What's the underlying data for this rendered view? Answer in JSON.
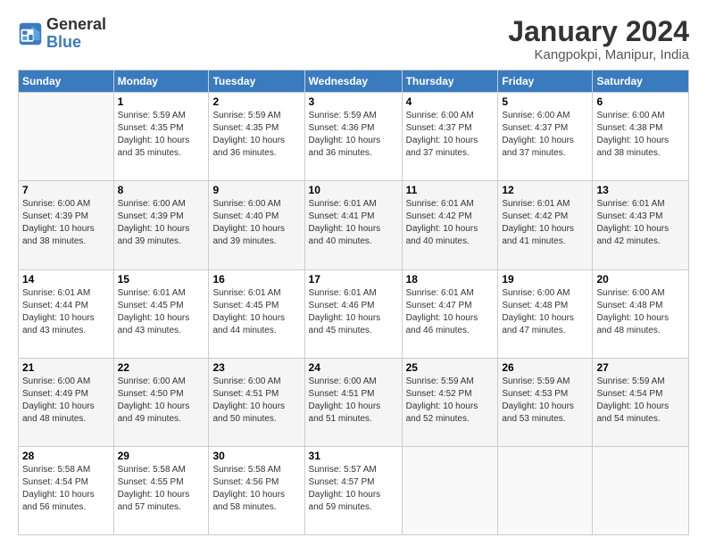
{
  "logo": {
    "text_general": "General",
    "text_blue": "Blue"
  },
  "title": "January 2024",
  "subtitle": "Kangpokpi, Manipur, India",
  "header_days": [
    "Sunday",
    "Monday",
    "Tuesday",
    "Wednesday",
    "Thursday",
    "Friday",
    "Saturday"
  ],
  "weeks": [
    [
      {
        "day": "",
        "info": ""
      },
      {
        "day": "1",
        "info": "Sunrise: 5:59 AM\nSunset: 4:35 PM\nDaylight: 10 hours\nand 35 minutes."
      },
      {
        "day": "2",
        "info": "Sunrise: 5:59 AM\nSunset: 4:35 PM\nDaylight: 10 hours\nand 36 minutes."
      },
      {
        "day": "3",
        "info": "Sunrise: 5:59 AM\nSunset: 4:36 PM\nDaylight: 10 hours\nand 36 minutes."
      },
      {
        "day": "4",
        "info": "Sunrise: 6:00 AM\nSunset: 4:37 PM\nDaylight: 10 hours\nand 37 minutes."
      },
      {
        "day": "5",
        "info": "Sunrise: 6:00 AM\nSunset: 4:37 PM\nDaylight: 10 hours\nand 37 minutes."
      },
      {
        "day": "6",
        "info": "Sunrise: 6:00 AM\nSunset: 4:38 PM\nDaylight: 10 hours\nand 38 minutes."
      }
    ],
    [
      {
        "day": "7",
        "info": "Sunrise: 6:00 AM\nSunset: 4:39 PM\nDaylight: 10 hours\nand 38 minutes."
      },
      {
        "day": "8",
        "info": "Sunrise: 6:00 AM\nSunset: 4:39 PM\nDaylight: 10 hours\nand 39 minutes."
      },
      {
        "day": "9",
        "info": "Sunrise: 6:00 AM\nSunset: 4:40 PM\nDaylight: 10 hours\nand 39 minutes."
      },
      {
        "day": "10",
        "info": "Sunrise: 6:01 AM\nSunset: 4:41 PM\nDaylight: 10 hours\nand 40 minutes."
      },
      {
        "day": "11",
        "info": "Sunrise: 6:01 AM\nSunset: 4:42 PM\nDaylight: 10 hours\nand 40 minutes."
      },
      {
        "day": "12",
        "info": "Sunrise: 6:01 AM\nSunset: 4:42 PM\nDaylight: 10 hours\nand 41 minutes."
      },
      {
        "day": "13",
        "info": "Sunrise: 6:01 AM\nSunset: 4:43 PM\nDaylight: 10 hours\nand 42 minutes."
      }
    ],
    [
      {
        "day": "14",
        "info": "Sunrise: 6:01 AM\nSunset: 4:44 PM\nDaylight: 10 hours\nand 43 minutes."
      },
      {
        "day": "15",
        "info": "Sunrise: 6:01 AM\nSunset: 4:45 PM\nDaylight: 10 hours\nand 43 minutes."
      },
      {
        "day": "16",
        "info": "Sunrise: 6:01 AM\nSunset: 4:45 PM\nDaylight: 10 hours\nand 44 minutes."
      },
      {
        "day": "17",
        "info": "Sunrise: 6:01 AM\nSunset: 4:46 PM\nDaylight: 10 hours\nand 45 minutes."
      },
      {
        "day": "18",
        "info": "Sunrise: 6:01 AM\nSunset: 4:47 PM\nDaylight: 10 hours\nand 46 minutes."
      },
      {
        "day": "19",
        "info": "Sunrise: 6:00 AM\nSunset: 4:48 PM\nDaylight: 10 hours\nand 47 minutes."
      },
      {
        "day": "20",
        "info": "Sunrise: 6:00 AM\nSunset: 4:48 PM\nDaylight: 10 hours\nand 48 minutes."
      }
    ],
    [
      {
        "day": "21",
        "info": "Sunrise: 6:00 AM\nSunset: 4:49 PM\nDaylight: 10 hours\nand 48 minutes."
      },
      {
        "day": "22",
        "info": "Sunrise: 6:00 AM\nSunset: 4:50 PM\nDaylight: 10 hours\nand 49 minutes."
      },
      {
        "day": "23",
        "info": "Sunrise: 6:00 AM\nSunset: 4:51 PM\nDaylight: 10 hours\nand 50 minutes."
      },
      {
        "day": "24",
        "info": "Sunrise: 6:00 AM\nSunset: 4:51 PM\nDaylight: 10 hours\nand 51 minutes."
      },
      {
        "day": "25",
        "info": "Sunrise: 5:59 AM\nSunset: 4:52 PM\nDaylight: 10 hours\nand 52 minutes."
      },
      {
        "day": "26",
        "info": "Sunrise: 5:59 AM\nSunset: 4:53 PM\nDaylight: 10 hours\nand 53 minutes."
      },
      {
        "day": "27",
        "info": "Sunrise: 5:59 AM\nSunset: 4:54 PM\nDaylight: 10 hours\nand 54 minutes."
      }
    ],
    [
      {
        "day": "28",
        "info": "Sunrise: 5:58 AM\nSunset: 4:54 PM\nDaylight: 10 hours\nand 56 minutes."
      },
      {
        "day": "29",
        "info": "Sunrise: 5:58 AM\nSunset: 4:55 PM\nDaylight: 10 hours\nand 57 minutes."
      },
      {
        "day": "30",
        "info": "Sunrise: 5:58 AM\nSunset: 4:56 PM\nDaylight: 10 hours\nand 58 minutes."
      },
      {
        "day": "31",
        "info": "Sunrise: 5:57 AM\nSunset: 4:57 PM\nDaylight: 10 hours\nand 59 minutes."
      },
      {
        "day": "",
        "info": ""
      },
      {
        "day": "",
        "info": ""
      },
      {
        "day": "",
        "info": ""
      }
    ]
  ]
}
